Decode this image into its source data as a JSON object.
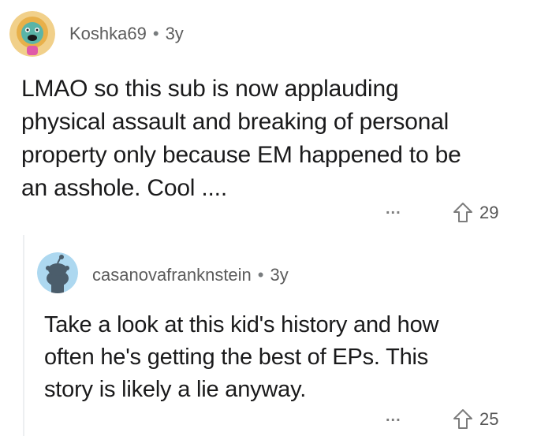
{
  "comments": [
    {
      "username": "Koshka69",
      "separator": "•",
      "age": "3y",
      "text": "LMAO so this sub is now applauding\nphysical  assault and breaking of personal\nproperty only because EM happened to be\nan asshole. Cool ....",
      "more": "...",
      "votes": "29"
    },
    {
      "username": "casanovafranknstein",
      "separator": "•",
      "age": "3y",
      "text": "Take a look at this kid's history and how\noften he's getting the best of EPs. This\nstory is likely a lie anyway.",
      "more": "...",
      "votes": "25"
    }
  ],
  "colors": {
    "snoo_bg": "#add8f0",
    "avatar1_bg": "#f1d08a",
    "upvote_icon": "#7c7c7c"
  }
}
